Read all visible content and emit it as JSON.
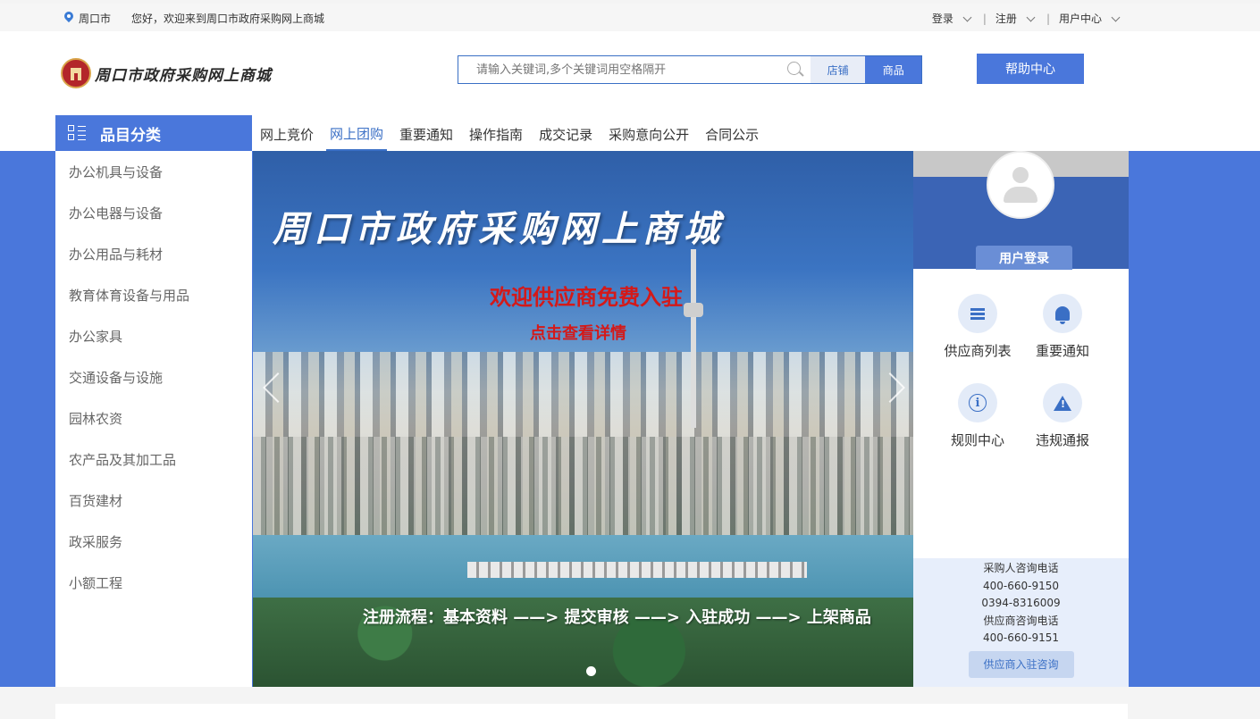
{
  "topbar": {
    "city": "周口市",
    "welcome": "您好，欢迎来到周口市政府采购网上商城",
    "login": "登录",
    "register": "注册",
    "user_center": "用户中心",
    "separator": "|"
  },
  "header": {
    "logo_text": "周口市政府采购网上商城",
    "search_placeholder": "请输入关键词,多个关键词用空格隔开",
    "btn_shop": "店铺",
    "btn_goods": "商品",
    "help_center": "帮助中心"
  },
  "nav": {
    "category_title": "品目分类",
    "items": [
      "网上竞价",
      "网上团购",
      "重要通知",
      "操作指南",
      "成交记录",
      "采购意向公开",
      "合同公示"
    ],
    "active_index": 1
  },
  "categories": [
    "办公机具与设备",
    "办公电器与设备",
    "办公用品与耗材",
    "教育体育设备与用品",
    "办公家具",
    "交通设备与设施",
    "园林农资",
    "农产品及其加工品",
    "百货建材",
    "政采服务",
    "小额工程"
  ],
  "banner": {
    "title": "周口市政府采购网上商城",
    "sub1": "欢迎供应商免费入驻",
    "sub2": "点击查看详情",
    "flow": "注册流程：基本资料 ——> 提交审核 ——> 入驻成功 ——> 上架商品"
  },
  "user_panel": {
    "login_label": "用户登录",
    "quick_links": [
      "供应商列表",
      "重要通知",
      "规则中心",
      "违规通报"
    ],
    "contact": {
      "buyer_label": "采购人咨询电话",
      "buyer_phone1": "400-660-9150",
      "buyer_phone2": "0394-8316009",
      "supplier_label": "供应商咨询电话",
      "supplier_phone": "400-660-9151",
      "consult_button": "供应商入驻咨询"
    }
  },
  "colors": {
    "brand_blue": "#4a77db",
    "link_blue": "#3a6fc5",
    "banner_red": "#d41919"
  }
}
